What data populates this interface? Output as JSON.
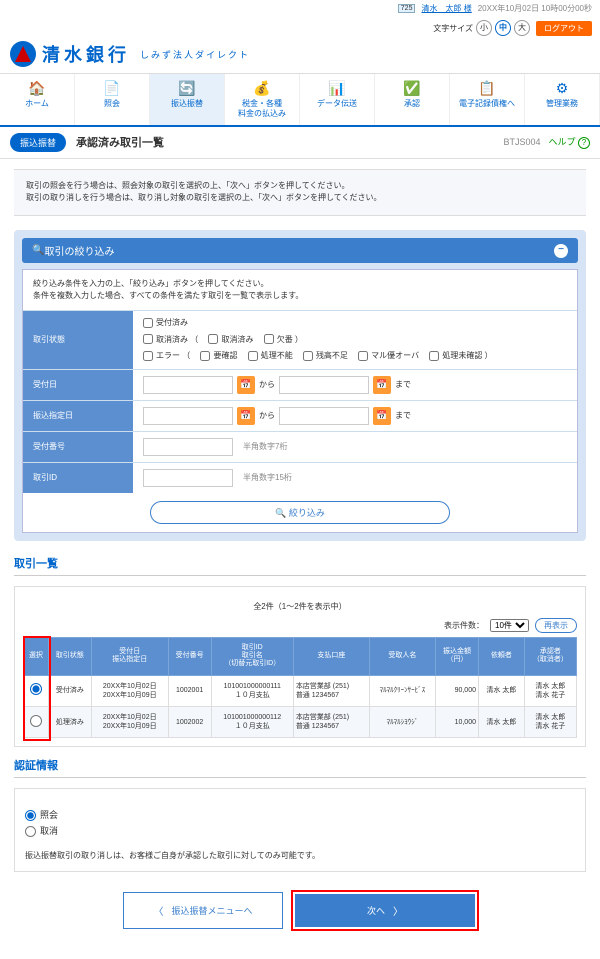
{
  "topbar": {
    "num": "725",
    "user": "清水　太郎 様",
    "time": "20XX年10月02日 10時00分00秒",
    "fontsize_label": "文字サイズ",
    "sizes": [
      "小",
      "中",
      "大"
    ],
    "logout": "ログアウト"
  },
  "logo": {
    "text": "清水銀行",
    "sub": "しみず法人ダイレクト"
  },
  "nav": [
    {
      "icon": "🏠",
      "label": "ホーム"
    },
    {
      "icon": "📄",
      "label": "照会"
    },
    {
      "icon": "🔄",
      "label": "振込振替"
    },
    {
      "icon": "💰",
      "label": "税金・各種\n料金の払込み"
    },
    {
      "icon": "📊",
      "label": "データ伝送"
    },
    {
      "icon": "✅",
      "label": "承認"
    },
    {
      "icon": "📋",
      "label": "電子記録債権へ"
    },
    {
      "icon": "⚙",
      "label": "管理業務"
    }
  ],
  "pagehead": {
    "cat": "振込振替",
    "title": "承認済み取引一覧",
    "code": "BTJS004",
    "help": "ヘルプ"
  },
  "note": {
    "l1": "取引の照会を行う場合は、照会対象の取引を選択の上、「次へ」ボタンを押してください。",
    "l2": "取引の取り消しを行う場合は、取り消し対象の取引を選択の上、「次へ」ボタンを押してください。"
  },
  "filter": {
    "title": "取引の絞り込み",
    "note1": "絞り込み条件を入力の上、「絞り込み」ボタンを押してください。",
    "note2": "条件を複数入力した場合、すべての条件を満たす取引を一覧で表示します。",
    "rows": {
      "status": "取引状態",
      "uketsuke": "受付日",
      "shitei": "振込指定日",
      "bangou": "受付番号",
      "torihikiid": "取引ID"
    },
    "checks": {
      "c1": "受付済み",
      "c2": "取消済み （",
      "c2a": "取消済み",
      "c2b": "欠番 ）",
      "c3": "エラー （",
      "c3a": "要確認",
      "c3b": "処理不能",
      "c3c": "残高不足",
      "c3d": "マル優オーバ",
      "c3e": "処理未確認 ）"
    },
    "from": "から",
    "to": "まで",
    "hint7": "半角数字7桁",
    "hint15": "半角数字15桁",
    "btn": "絞り込み"
  },
  "list": {
    "title": "取引一覧",
    "count": "全2件（1～2件を表示中）",
    "pager_label": "表示件数：",
    "pager_val": "10件",
    "reload": "再表示",
    "cols": [
      "選択",
      "取引状態",
      "受付日\n振込指定日",
      "受付番号",
      "取引ID\n取引名\n（切替元取引ID）",
      "支払口座",
      "受取人名",
      "振込金額\n（円）",
      "依頼者",
      "承認者\n（取消者）"
    ],
    "rows": [
      {
        "status": "受付済み",
        "dates": "20XX年10月02日\n20XX年10月09日",
        "num": "1002001",
        "id": "101001000000111\n１０月支払",
        "acct": "本店営業部 (251)\n普通 1234567",
        "payee": "ﾏﾙﾏﾙｸﾘｰﾝｻｰﾋﾞｽ",
        "amt": "90,000",
        "req": "清水 太郎",
        "app": "清水 太郎\n清水 花子",
        "sel": true
      },
      {
        "status": "処理済み",
        "dates": "20XX年10月02日\n20XX年10月09日",
        "num": "1002002",
        "id": "101001000000112\n１０月支払",
        "acct": "本店営業部 (251)\n普通 1234567",
        "payee": "ﾏﾙﾏﾙｼﾖｳｼﾞ",
        "amt": "10,000",
        "req": "清水 太郎",
        "app": "清水 太郎\n清水 花子",
        "sel": false
      }
    ]
  },
  "auth": {
    "title": "認証情報",
    "o1": "照会",
    "o2": "取消",
    "note": "振込振替取引の取り消しは、お客様ご自身が承認した取引に対してのみ可能です。"
  },
  "actions": {
    "back": "振込振替メニューへ",
    "next": "次へ"
  }
}
